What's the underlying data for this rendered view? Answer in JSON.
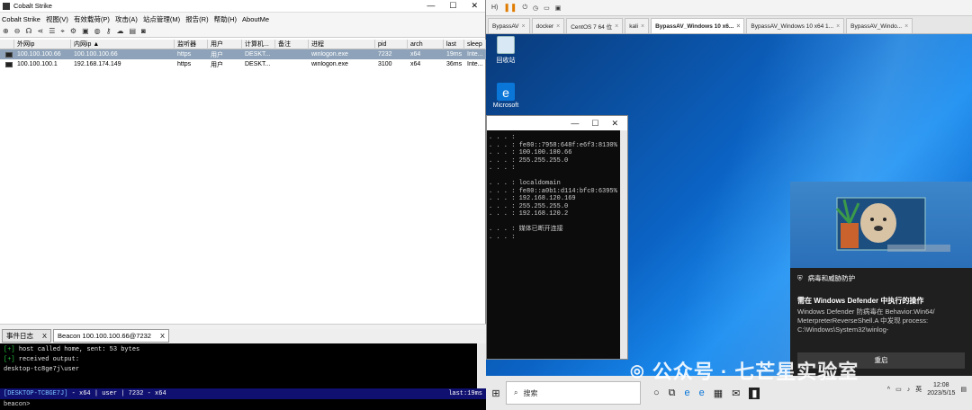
{
  "cs": {
    "title": "Cobalt Strike",
    "menu": [
      "Cobalt Strike",
      "视图(V)",
      "有效载荷(P)",
      "攻击(A)",
      "站点管理(M)",
      "报告(R)",
      "帮助(H)",
      "AboutMe"
    ],
    "columns": [
      "",
      "外网ip",
      "内网ip ▲",
      "监听器",
      "用户",
      "计算机...",
      "备注",
      "进程",
      "pid",
      "arch",
      "last",
      "sleep"
    ],
    "rows": [
      {
        "ext": "100.100.100.66",
        "int": "100.100.100.66",
        "listener": "https",
        "user": "用户",
        "computer": "DESKT...",
        "note": "",
        "process": "winlogon.exe",
        "pid": "7232",
        "arch": "x64",
        "last": "19ms",
        "sleep": "Inte..."
      },
      {
        "ext": "100.100.100.1",
        "int": "192.168.174.149",
        "listener": "https",
        "user": "用户",
        "computer": "DESKT...",
        "note": "",
        "process": "winlogon.exe",
        "pid": "3100",
        "arch": "x64",
        "last": "36ms",
        "sleep": "Inte..."
      }
    ],
    "tabs": [
      {
        "label": "事件日志",
        "close": "X"
      },
      {
        "label": "Beacon 100.100.100.66@7232",
        "close": "X"
      }
    ],
    "console": {
      "l1_tag": "[+]",
      "l1": "host called home, sent: 53 bytes",
      "l2_tag": "[+]",
      "l2": "received output:",
      "l3": "desktop-tc8ge7j\\user"
    },
    "status": {
      "host": "[DESKTOP-TCBGE7J]",
      "rest": " - x64 | user | 7232 - x64",
      "last": "last:19ms"
    },
    "prompt": "beacon>"
  },
  "vm": {
    "tabs": [
      "BypassAV",
      "docker",
      "CentOS 7 64 位",
      "kali",
      "BypassAV_Windows 10 x6...",
      "BypassAV_Windows 10 x64 1...",
      "BypassAV_Windo..."
    ],
    "toolbar_label": "H)"
  },
  "desktop": {
    "icons": [
      "回收站",
      "Microsoft"
    ],
    "cmd_lines": [
      ". . . :",
      ". . . : fe80::7958:648f:e6f3:8130%",
      ". . . : 100.100.100.66",
      ". . . : 255.255.255.0",
      ". . . :",
      "",
      ". . . : localdomain",
      ". . . : fe80::a0b1:d114:bfc0:6395%",
      ". . . : 192.168.120.169",
      ". . . : 255.255.255.0",
      ". . . : 192.168.120.2",
      "",
      ". . . : 媒体已断开连接",
      ". . . :"
    ],
    "notif": {
      "head": "病毒和威胁防护",
      "title": "需在 Windows Defender 中执行的操作",
      "text": "Windows Defender 防病毒在 Behavior:Win64/ MeterpreterReverseShell.A 中发现 process: C:\\Windows\\System32\\winlog-",
      "button": "重启"
    },
    "watermark": "公众号 · 七芒星实验室",
    "search": "搜索",
    "time": "12:08",
    "date": "2023/5/15",
    "ime": "英"
  }
}
